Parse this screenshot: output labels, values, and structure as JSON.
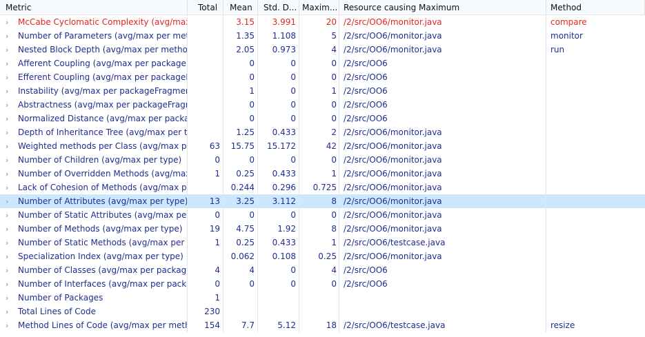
{
  "columns": {
    "metric": "Metric",
    "total": "Total",
    "mean": "Mean",
    "std": "Std. D...",
    "max": "Maxim...",
    "resource": "Resource causing Maximum",
    "method": "Method"
  },
  "expander_icon": "chevron-right-icon",
  "colors": {
    "text": "#1f2d8f",
    "error": "#e0261f",
    "selected": "#cce8ff",
    "grid": "#e5e5e5"
  },
  "rows": [
    {
      "metric": "McCabe Cyclomatic Complexity (avg/max",
      "total": "",
      "mean": "3.15",
      "std": "3.991",
      "max": "20",
      "resource": "/2/src/OO6/monitor.java",
      "method": "compare",
      "state": "error"
    },
    {
      "metric": "Number of Parameters (avg/max per meth",
      "total": "",
      "mean": "1.35",
      "std": "1.108",
      "max": "5",
      "resource": "/2/src/OO6/monitor.java",
      "method": "monitor",
      "state": ""
    },
    {
      "metric": "Nested Block Depth (avg/max per methoc",
      "total": "",
      "mean": "2.05",
      "std": "0.973",
      "max": "4",
      "resource": "/2/src/OO6/monitor.java",
      "method": "run",
      "state": ""
    },
    {
      "metric": "Afferent Coupling (avg/max per packageF",
      "total": "",
      "mean": "0",
      "std": "0",
      "max": "0",
      "resource": "/2/src/OO6",
      "method": "",
      "state": ""
    },
    {
      "metric": "Efferent Coupling (avg/max per packageFi",
      "total": "",
      "mean": "0",
      "std": "0",
      "max": "0",
      "resource": "/2/src/OO6",
      "method": "",
      "state": ""
    },
    {
      "metric": "Instability (avg/max per packageFragment",
      "total": "",
      "mean": "1",
      "std": "0",
      "max": "1",
      "resource": "/2/src/OO6",
      "method": "",
      "state": ""
    },
    {
      "metric": "Abstractness (avg/max per packageFragm",
      "total": "",
      "mean": "0",
      "std": "0",
      "max": "0",
      "resource": "/2/src/OO6",
      "method": "",
      "state": ""
    },
    {
      "metric": "Normalized Distance (avg/max per packag",
      "total": "",
      "mean": "0",
      "std": "0",
      "max": "0",
      "resource": "/2/src/OO6",
      "method": "",
      "state": ""
    },
    {
      "metric": "Depth of Inheritance Tree (avg/max per ty",
      "total": "",
      "mean": "1.25",
      "std": "0.433",
      "max": "2",
      "resource": "/2/src/OO6/monitor.java",
      "method": "",
      "state": ""
    },
    {
      "metric": "Weighted methods per Class (avg/max pe",
      "total": "63",
      "mean": "15.75",
      "std": "15.172",
      "max": "42",
      "resource": "/2/src/OO6/monitor.java",
      "method": "",
      "state": ""
    },
    {
      "metric": "Number of Children (avg/max per type)",
      "total": "0",
      "mean": "0",
      "std": "0",
      "max": "0",
      "resource": "/2/src/OO6/monitor.java",
      "method": "",
      "state": ""
    },
    {
      "metric": "Number of Overridden Methods (avg/max",
      "total": "1",
      "mean": "0.25",
      "std": "0.433",
      "max": "1",
      "resource": "/2/src/OO6/monitor.java",
      "method": "",
      "state": ""
    },
    {
      "metric": "Lack of Cohesion of Methods (avg/max pe",
      "total": "",
      "mean": "0.244",
      "std": "0.296",
      "max": "0.725",
      "resource": "/2/src/OO6/monitor.java",
      "method": "",
      "state": ""
    },
    {
      "metric": "Number of Attributes (avg/max per type)",
      "total": "13",
      "mean": "3.25",
      "std": "3.112",
      "max": "8",
      "resource": "/2/src/OO6/monitor.java",
      "method": "",
      "state": "selected"
    },
    {
      "metric": "Number of Static Attributes (avg/max per",
      "total": "0",
      "mean": "0",
      "std": "0",
      "max": "0",
      "resource": "/2/src/OO6/monitor.java",
      "method": "",
      "state": ""
    },
    {
      "metric": "Number of Methods (avg/max per type)",
      "total": "19",
      "mean": "4.75",
      "std": "1.92",
      "max": "8",
      "resource": "/2/src/OO6/monitor.java",
      "method": "",
      "state": ""
    },
    {
      "metric": "Number of Static Methods (avg/max per t",
      "total": "1",
      "mean": "0.25",
      "std": "0.433",
      "max": "1",
      "resource": "/2/src/OO6/testcase.java",
      "method": "",
      "state": ""
    },
    {
      "metric": "Specialization Index (avg/max per type)",
      "total": "",
      "mean": "0.062",
      "std": "0.108",
      "max": "0.25",
      "resource": "/2/src/OO6/monitor.java",
      "method": "",
      "state": ""
    },
    {
      "metric": "Number of Classes (avg/max per package",
      "total": "4",
      "mean": "4",
      "std": "0",
      "max": "4",
      "resource": "/2/src/OO6",
      "method": "",
      "state": ""
    },
    {
      "metric": "Number of Interfaces (avg/max per packa",
      "total": "0",
      "mean": "0",
      "std": "0",
      "max": "0",
      "resource": "/2/src/OO6",
      "method": "",
      "state": ""
    },
    {
      "metric": "Number of Packages",
      "total": "1",
      "mean": "",
      "std": "",
      "max": "",
      "resource": "",
      "method": "",
      "state": ""
    },
    {
      "metric": "Total Lines of Code",
      "total": "230",
      "mean": "",
      "std": "",
      "max": "",
      "resource": "",
      "method": "",
      "state": ""
    },
    {
      "metric": "Method Lines of Code (avg/max per meth",
      "total": "154",
      "mean": "7.7",
      "std": "5.12",
      "max": "18",
      "resource": "/2/src/OO6/testcase.java",
      "method": "resize",
      "state": ""
    }
  ]
}
